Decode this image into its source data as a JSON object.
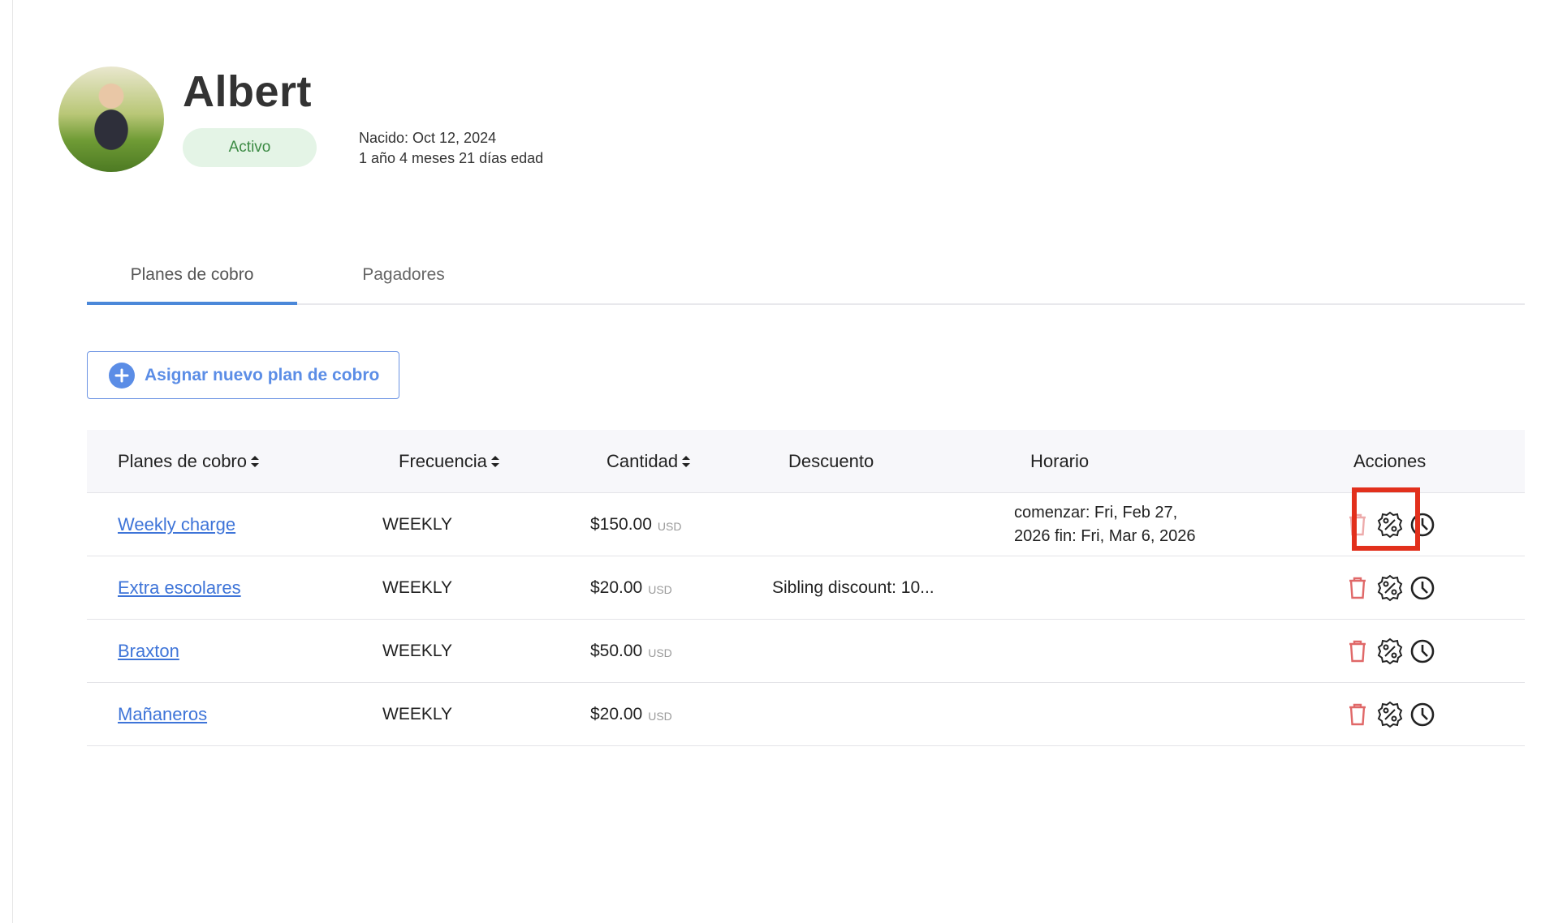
{
  "profile": {
    "name": "Albert",
    "status": "Activo",
    "born": "Nacido: Oct 12, 2024",
    "age": "1 año 4 meses 21 días edad"
  },
  "tabs": [
    {
      "label": "Planes de cobro",
      "active": true
    },
    {
      "label": "Pagadores",
      "active": false
    }
  ],
  "assign_button": {
    "label": "Asignar nuevo plan de cobro"
  },
  "table": {
    "headers": {
      "plan": "Planes de cobro",
      "frequency": "Frecuencia",
      "amount": "Cantidad",
      "discount": "Descuento",
      "schedule": "Horario",
      "actions": "Acciones"
    },
    "rows": [
      {
        "plan": "Weekly charge",
        "frequency": "WEEKLY",
        "amount": "$150.00",
        "currency": "USD",
        "discount": "",
        "schedule_line1": "comenzar: Fri, Feb 27,",
        "schedule_line2": "2026 fin: Fri, Mar 6, 2026"
      },
      {
        "plan": "Extra escolares",
        "frequency": "WEEKLY",
        "amount": "$20.00",
        "currency": "USD",
        "discount": "Sibling discount: 10...",
        "schedule_line1": "",
        "schedule_line2": ""
      },
      {
        "plan": "Braxton",
        "frequency": "WEEKLY",
        "amount": "$50.00",
        "currency": "USD",
        "discount": "",
        "schedule_line1": "",
        "schedule_line2": ""
      },
      {
        "plan": "Mañaneros",
        "frequency": "WEEKLY",
        "amount": "$20.00",
        "currency": "USD",
        "discount": "",
        "schedule_line1": "",
        "schedule_line2": ""
      }
    ]
  },
  "icons": {
    "delete": "trash-icon",
    "discount": "percent-badge-icon",
    "schedule": "clock-icon",
    "sort": "sort-icon",
    "add": "plus-circle-icon"
  },
  "colors": {
    "link": "#3e74d8",
    "accent": "#5b8de6",
    "status_bg": "#e4f4e6",
    "status_text": "#3b8a43",
    "delete_icon": "#e06868",
    "highlight": "#e2301c"
  }
}
